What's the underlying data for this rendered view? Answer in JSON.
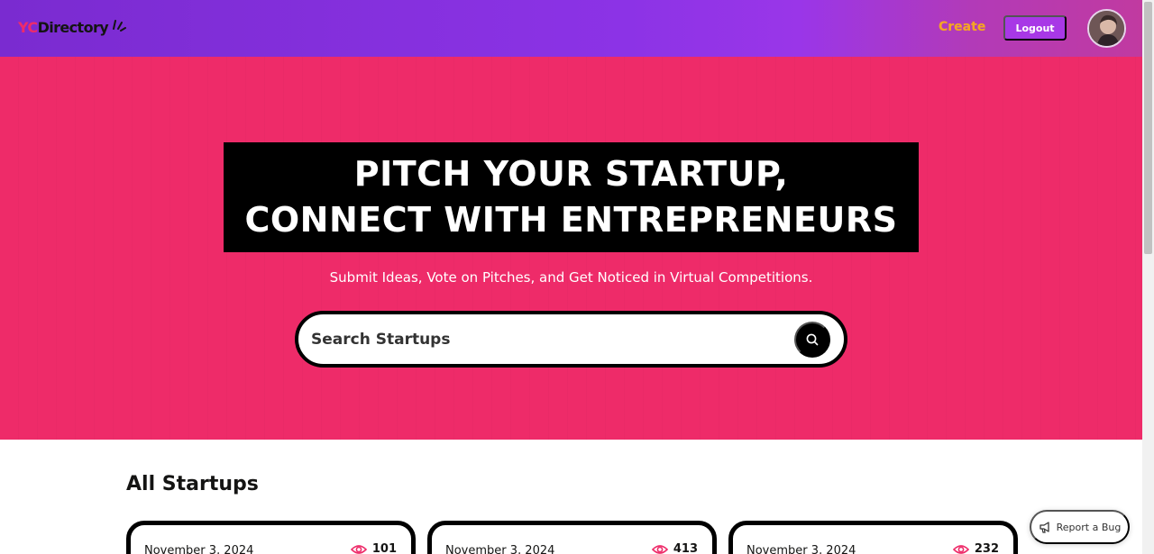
{
  "navbar": {
    "logo_yc": "YC",
    "logo_directory": "Directory",
    "create_label": "Create",
    "logout_label": "Logout"
  },
  "hero": {
    "title_line1": "PITCH YOUR STARTUP,",
    "title_line2": "CONNECT WITH ENTREPRENEURS",
    "subtitle": "Submit Ideas, Vote on Pitches, and Get Noticed in Virtual Competitions.",
    "search_placeholder": "Search Startups"
  },
  "startups": {
    "heading": "All Startups",
    "cards": [
      {
        "date": "November 3, 2024",
        "views": "101"
      },
      {
        "date": "November 3, 2024",
        "views": "413"
      },
      {
        "date": "November 3, 2024",
        "views": "232"
      }
    ]
  },
  "report_bug": {
    "label": "Report a Bug"
  },
  "icons": {
    "search": "search-icon",
    "eye": "eye-icon",
    "megaphone": "megaphone-icon",
    "spark": "spark-icon"
  },
  "colors": {
    "primary": "#ee2b69",
    "nav_gradient_start": "#7a2bd0",
    "nav_gradient_end": "#c13aa0",
    "create": "#f5a623",
    "logout_bg": "#a838e6",
    "black": "#000000"
  }
}
